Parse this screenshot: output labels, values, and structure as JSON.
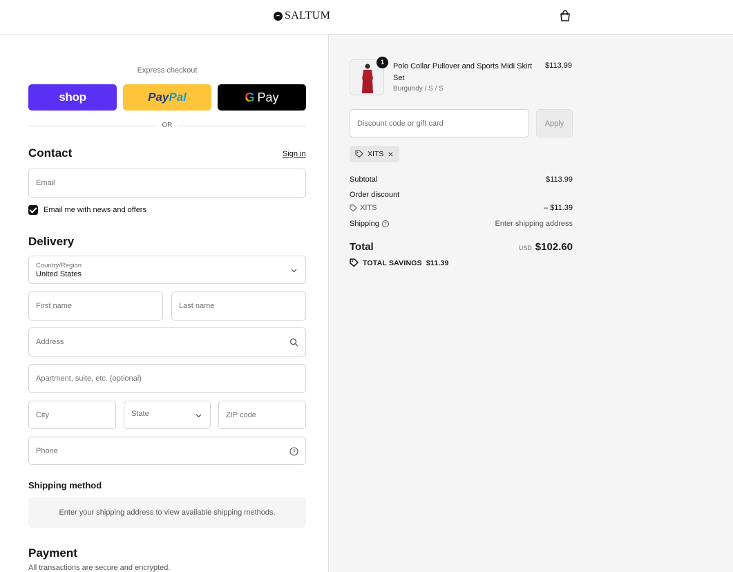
{
  "header": {
    "brand": "SALTUM"
  },
  "express": {
    "label": "Express checkout",
    "shop_label": "shop",
    "paypal_label_a": "Pay",
    "paypal_label_b": "Pal",
    "gpay_label": "Pay",
    "or_label": "OR"
  },
  "contact": {
    "title": "Contact",
    "sign_in": "Sign in",
    "email_placeholder": "Email",
    "newsletter_label": "Email me with news and offers",
    "newsletter_checked": true
  },
  "delivery": {
    "title": "Delivery",
    "country_label": "Country/Region",
    "country_value": "United States",
    "first_name_placeholder": "First name",
    "last_name_placeholder": "Last name",
    "address_placeholder": "Address",
    "apartment_placeholder": "Apartment, suite, etc. (optional)",
    "city_placeholder": "City",
    "state_placeholder": "State",
    "zip_placeholder": "ZIP code",
    "phone_placeholder": "Phone"
  },
  "shipping_method": {
    "title": "Shipping method",
    "message": "Enter your shipping address to view available shipping methods."
  },
  "payment": {
    "title": "Payment",
    "subtitle": "All transactions are secure and encrypted."
  },
  "order": {
    "item": {
      "name": "Polo Collar Pullover and Sports Midi Skirt Set",
      "variant": "Burgundy / S / S",
      "price": "$113.99",
      "quantity": "1"
    },
    "discount_placeholder": "Discount code or gift card",
    "apply_label": "Apply",
    "applied_code": "XITS",
    "subtotal_label": "Subtotal",
    "subtotal_value": "$113.99",
    "order_discount_label": "Order discount",
    "discount_code": "XITS",
    "discount_value": "– $11.39",
    "shipping_label": "Shipping",
    "shipping_value": "Enter shipping address",
    "total_label": "Total",
    "currency": "USD",
    "total_value": "$102.60",
    "savings_label": "TOTAL SAVINGS",
    "savings_value": "$11.39"
  },
  "colors": {
    "shop_purple": "#5a31f4",
    "paypal_yellow": "#ffc439",
    "gpay_black": "#000000",
    "summary_bg": "#f5f5f5"
  }
}
